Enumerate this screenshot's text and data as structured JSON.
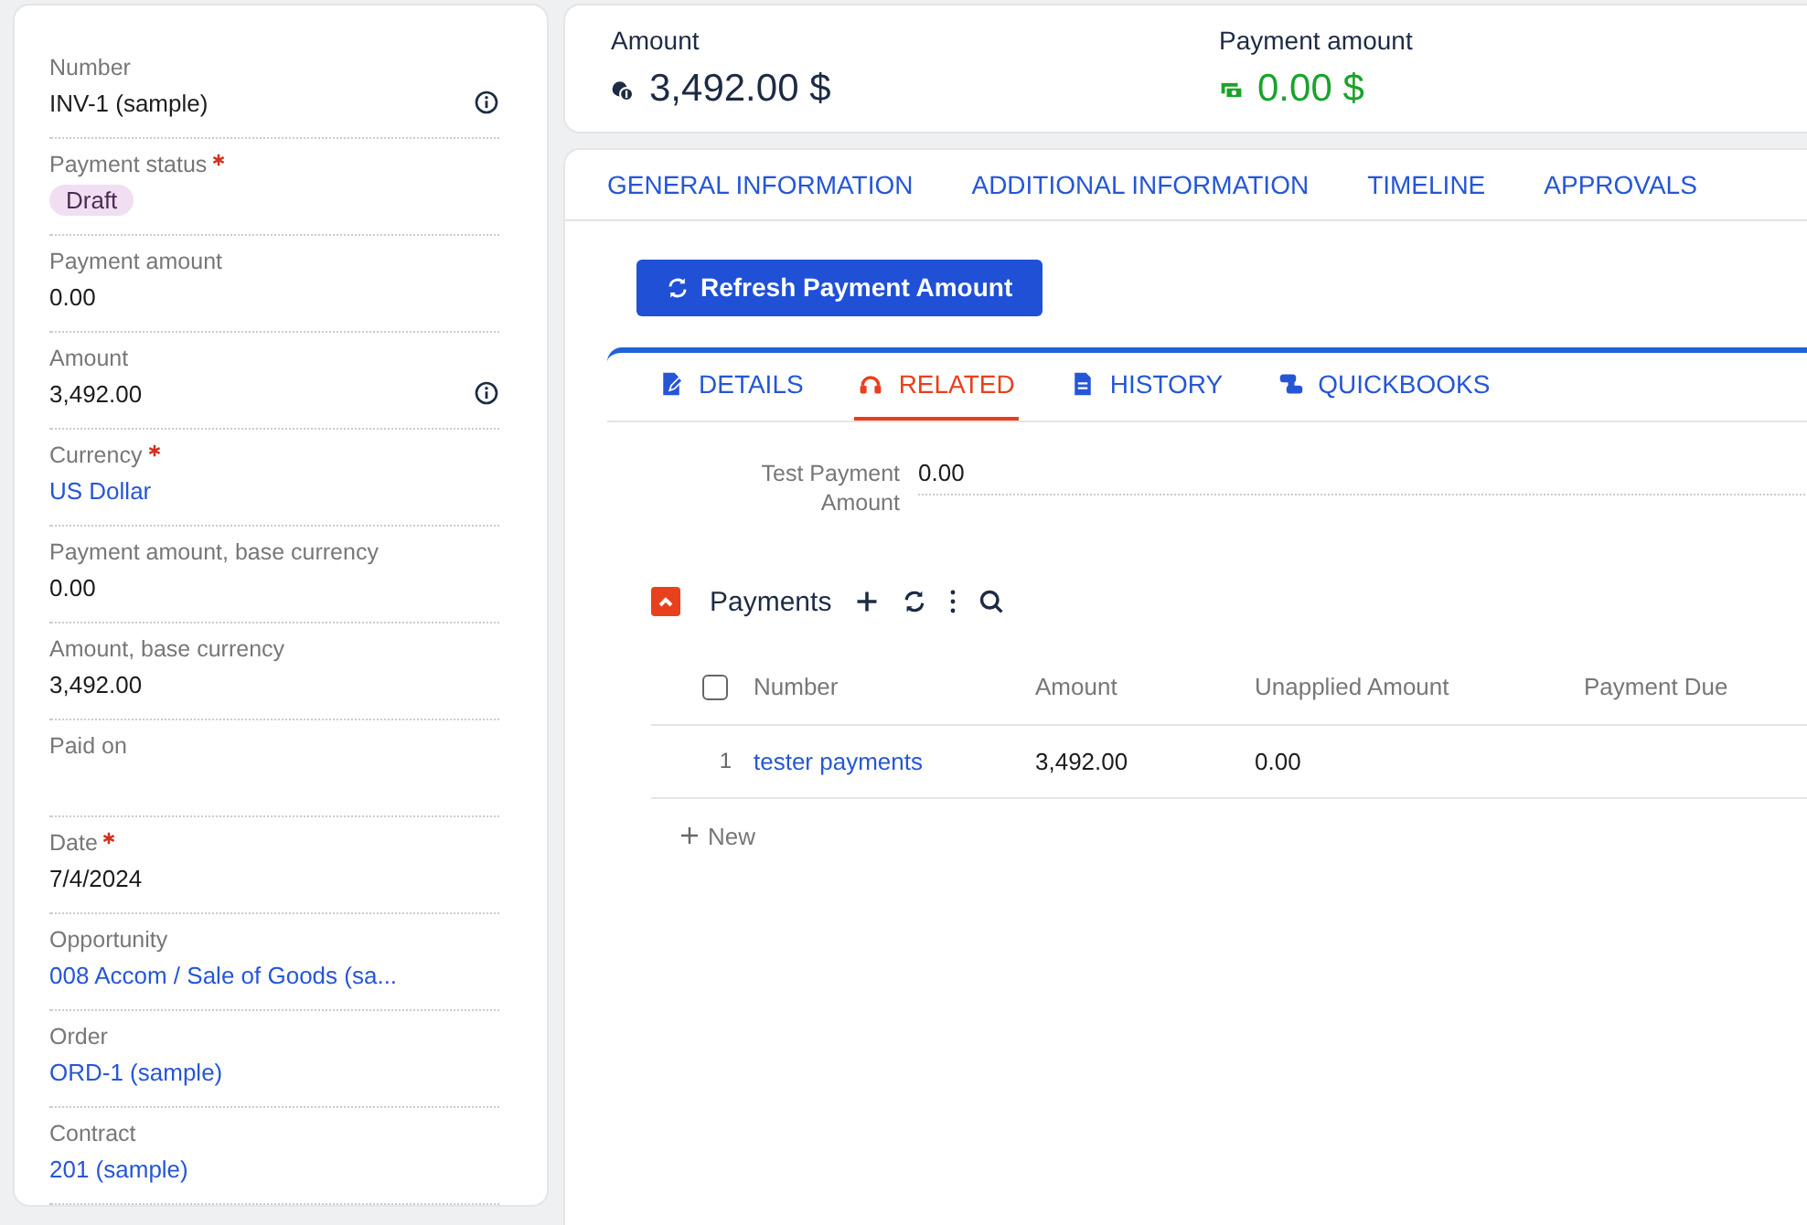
{
  "sidebar": {
    "fields": [
      {
        "label": "Number",
        "required": false,
        "kind": "text",
        "value": "INV-1 (sample)",
        "info": true
      },
      {
        "label": "Payment status",
        "required": true,
        "kind": "badge",
        "value": "Draft",
        "info": false
      },
      {
        "label": "Payment amount",
        "required": false,
        "kind": "text",
        "value": "0.00",
        "info": false
      },
      {
        "label": "Amount",
        "required": false,
        "kind": "text",
        "value": "3,492.00",
        "info": true
      },
      {
        "label": "Currency",
        "required": true,
        "kind": "link",
        "value": "US Dollar",
        "info": false
      },
      {
        "label": "Payment amount, base currency",
        "required": false,
        "kind": "text",
        "value": "0.00",
        "info": false
      },
      {
        "label": "Amount, base currency",
        "required": false,
        "kind": "text",
        "value": "3,492.00",
        "info": false
      },
      {
        "label": "Paid on",
        "required": false,
        "kind": "empty",
        "info": false
      },
      {
        "label": "Date",
        "required": true,
        "kind": "text",
        "value": "7/4/2024",
        "info": false
      },
      {
        "label": "Opportunity",
        "required": false,
        "kind": "link",
        "value": "008 Accom / Sale of Goods (sa...",
        "info": false
      },
      {
        "label": "Order",
        "required": false,
        "kind": "link",
        "value": "ORD-1 (sample)",
        "info": false
      },
      {
        "label": "Contract",
        "required": false,
        "kind": "link",
        "value": "201 (sample)",
        "info": false
      }
    ]
  },
  "summary": [
    {
      "label": "Amount",
      "value": "3,492.00 $",
      "kind": "total"
    },
    {
      "label": "Payment amount",
      "value": "0.00 $",
      "kind": "paid"
    }
  ],
  "tabs": [
    {
      "label": "GENERAL INFORMATION",
      "selected": false
    },
    {
      "label": "ADDITIONAL INFORMATION",
      "selected": false
    },
    {
      "label": "TIMELINE",
      "selected": false
    },
    {
      "label": "APPROVALS",
      "selected": false
    }
  ],
  "action_button": {
    "label": "Refresh Payment Amount"
  },
  "subtabs": [
    {
      "label": "DETAILS",
      "kind": "edit",
      "selected": false
    },
    {
      "label": "RELATED",
      "kind": "related",
      "selected": true
    },
    {
      "label": "HISTORY",
      "kind": "document",
      "selected": false
    },
    {
      "label": "QUICKBOOKS",
      "kind": "sync",
      "selected": false
    }
  ],
  "details": [
    {
      "label": "Test Payment Amount",
      "value": "0.00"
    }
  ],
  "payments": {
    "title": "Payments",
    "expanded": true,
    "select_all": {
      "checked": false
    },
    "columns": [
      "Number",
      "Amount",
      "Unapplied Amount",
      "Payment Due"
    ],
    "rows": [
      {
        "index": "1",
        "number": "tester payments",
        "amount": "3,492.00",
        "unapplied": "0.00"
      }
    ],
    "new_label": "New"
  }
}
